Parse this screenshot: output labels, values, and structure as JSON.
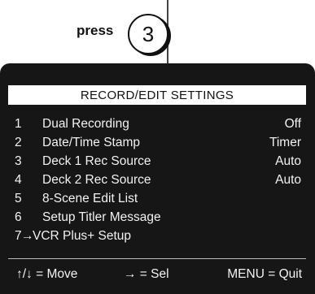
{
  "instruction": {
    "press_label": "press",
    "key": "3"
  },
  "menu": {
    "title": "RECORD/EDIT SETTINGS",
    "items": [
      {
        "num": "1",
        "label": "Dual Recording",
        "value": "Off"
      },
      {
        "num": "2",
        "label": "Date/Time Stamp",
        "value": "Timer"
      },
      {
        "num": "3",
        "label": "Deck 1 Rec Source",
        "value": "Auto"
      },
      {
        "num": "4",
        "label": "Deck 2 Rec Source",
        "value": "Auto"
      },
      {
        "num": "5",
        "label": "8-Scene Edit List",
        "value": ""
      },
      {
        "num": "6",
        "label": "Setup Titler Message",
        "value": ""
      },
      {
        "num": "7",
        "label": "VCR Plus+ Setup",
        "value": "",
        "selected": true,
        "cursor": "→"
      }
    ]
  },
  "footer": {
    "move": "↑/↓ = Move",
    "sel": "→ = Sel",
    "quit": "MENU = Quit"
  },
  "colors": {
    "screen_bg": "#161616",
    "text": "#f2f2f2",
    "header_bg": "#ffffff"
  }
}
